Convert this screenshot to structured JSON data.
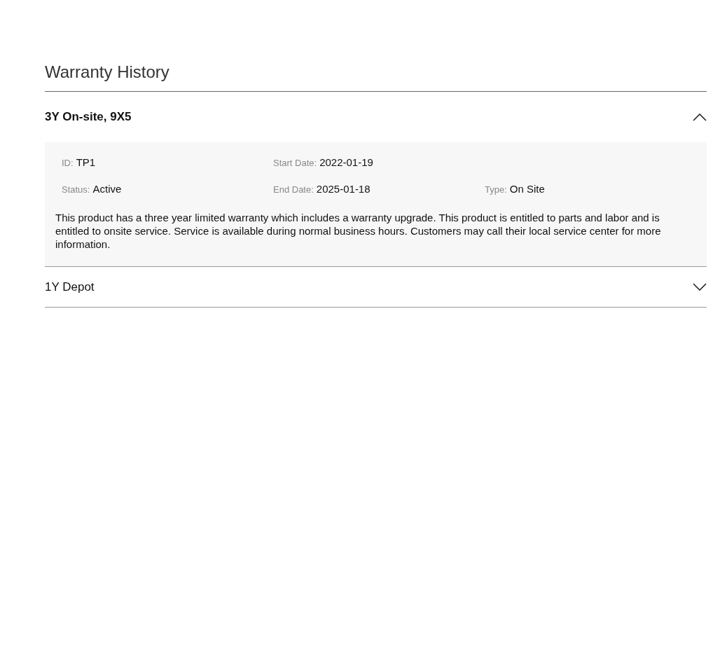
{
  "heading": "Warranty History",
  "sections": [
    {
      "title": "3Y On-site, 9X5",
      "expanded": true,
      "field_rows": [
        [
          {
            "label": "ID:",
            "value": "TP1"
          },
          {
            "label": "Start Date:",
            "value": "2022-01-19"
          }
        ],
        [
          {
            "label": "Status:",
            "value": "Active"
          },
          {
            "label": "End Date:",
            "value": "2025-01-18"
          },
          {
            "label": "Type:",
            "value": "On Site"
          }
        ]
      ],
      "description": "This product has a three year limited warranty which includes a warranty upgrade. This product is entitled to parts and labor and is entitled to onsite service. Service is available during normal business hours. Customers may call their local service center for more information."
    },
    {
      "title": "1Y Depot",
      "expanded": false
    }
  ]
}
